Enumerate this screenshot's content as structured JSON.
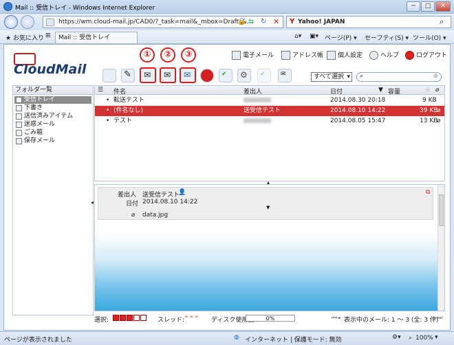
{
  "window": {
    "title": "Mail :: 受信トレイ - Windows Internet Explorer"
  },
  "address": {
    "url": "https://wm.cloud-mail.jp/CAD0/?_task=mail&_mbox=Drafts&...",
    "search_engine": "Yahoo! JAPAN"
  },
  "tabs": {
    "favorites": "お気に入り",
    "active_tab": "Mail :: 受信トレイ"
  },
  "ie_toolbar": {
    "page": "ページ(P) ▾",
    "safety": "セーフティ(S) ▾",
    "tools": "ツール(O) ▾"
  },
  "app": {
    "logo": "CloudMail",
    "topnav": [
      {
        "label": "電子メール"
      },
      {
        "label": "アドレス帳"
      },
      {
        "label": "個人設定"
      },
      {
        "label": "ヘルプ"
      },
      {
        "label": "ログアウト"
      }
    ],
    "callouts": [
      "①",
      "②",
      "③"
    ],
    "select_all": "すべて選択",
    "folders_header": "フォルダ一覧",
    "folders": [
      {
        "label": "受信トレイ"
      },
      {
        "label": "下書き"
      },
      {
        "label": "送信済みアイテム"
      },
      {
        "label": "迷惑メール"
      },
      {
        "label": "ごみ箱"
      },
      {
        "label": "保存メール"
      }
    ],
    "list": {
      "headers": {
        "subject": "件名",
        "from": "差出人",
        "date": "日付",
        "size": "容量"
      },
      "rows": [
        {
          "subject": "転送テスト",
          "from": "",
          "date": "2014.08.30 20:18",
          "size": "9 KB"
        },
        {
          "subject": "(件名なし)",
          "from": "送受信テスト",
          "date": "2014.08.10 14:22",
          "size": "39 KB"
        },
        {
          "subject": "テスト",
          "from": "",
          "date": "2014.08.05 15:47",
          "size": "13 KB"
        }
      ]
    },
    "preview": {
      "from_label": "差出人",
      "from_value": "送受信テスト",
      "date_label": "日付",
      "date_value": "2014.08.10 14:22",
      "attachment": "data.jpg"
    },
    "bottom": {
      "select_label": "選択:",
      "thread_label": "スレッド:",
      "disk_label": "ディスク使用量:",
      "disk_value": "0%",
      "page_info": "表示中のメール: 1 ～ 3 (全: 3 件)"
    }
  },
  "status": {
    "left": "ページが表示されました",
    "zone": "インターネット | 保護モード: 無効",
    "zoom": "100%"
  },
  "colors": {
    "accent": "#d23232",
    "brand": "#1a3b73"
  }
}
